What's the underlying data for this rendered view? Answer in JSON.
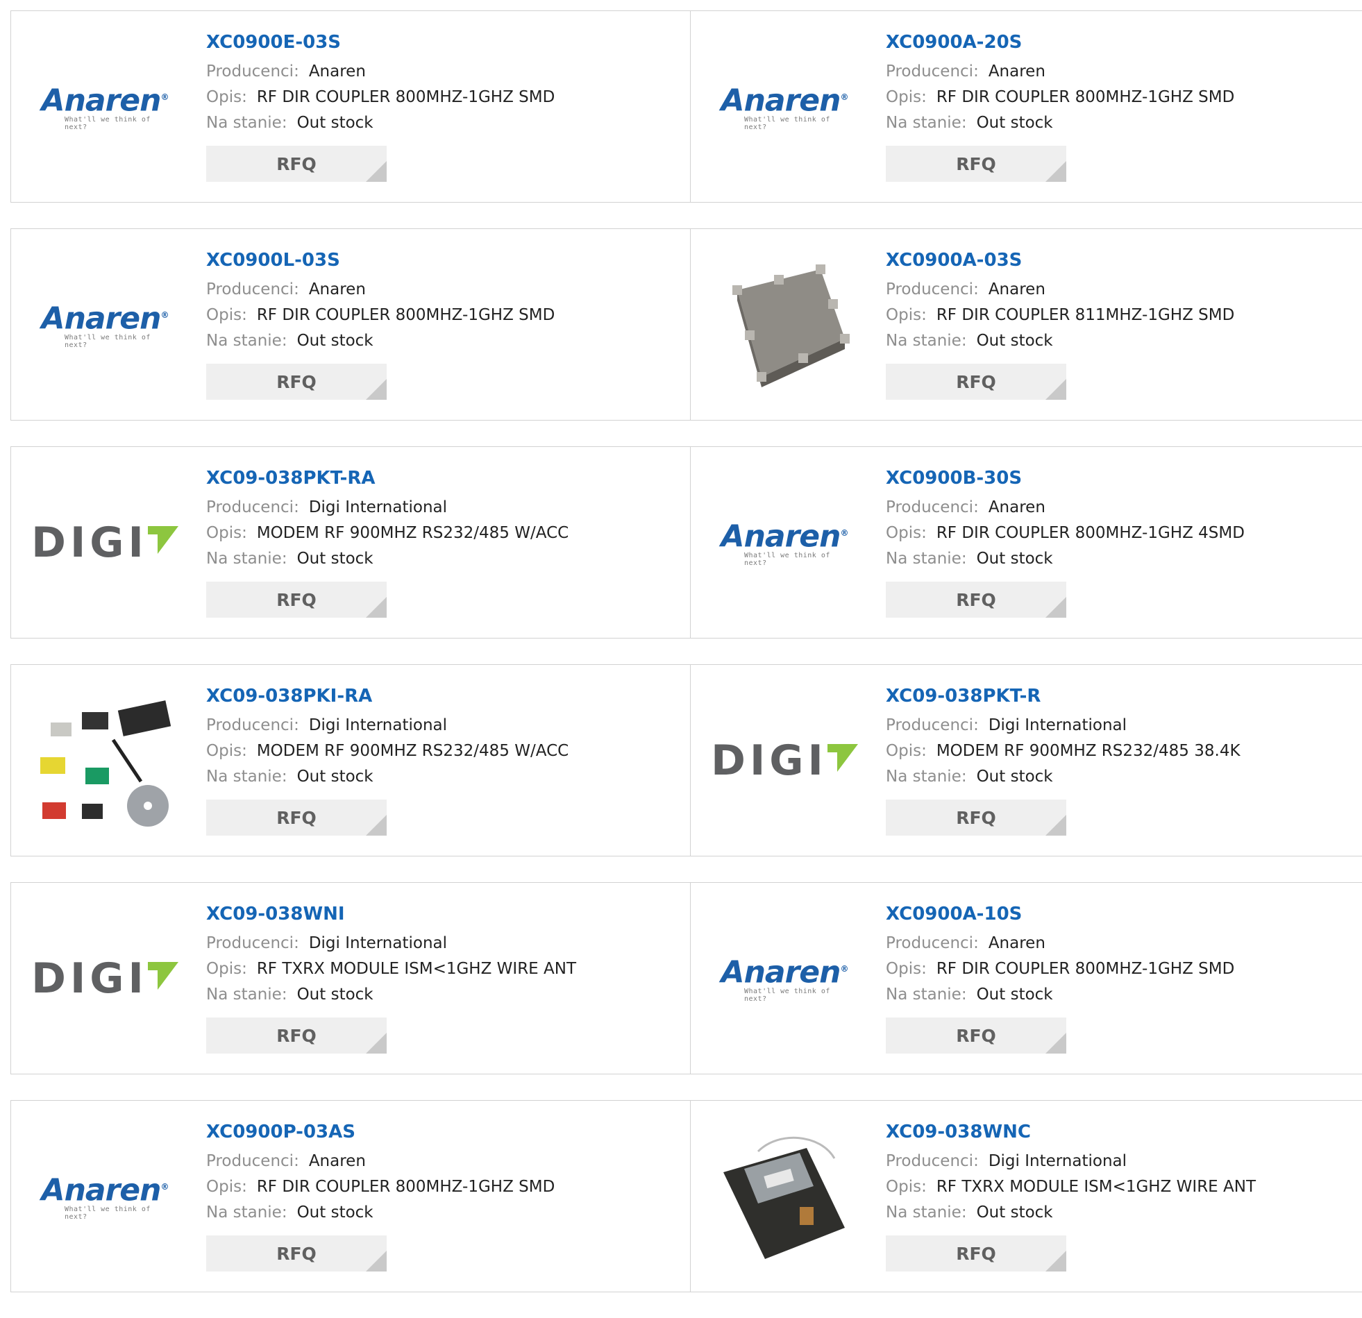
{
  "labels": {
    "manufacturer": "Producenci:",
    "description": "Opis:",
    "stock": "Na stanie:",
    "rfq": "RFQ"
  },
  "products": [
    {
      "pn": "XC0900E-03S",
      "manufacturer": "Anaren",
      "description": "RF DIR COUPLER 800MHZ-1GHZ SMD",
      "stock": "Out stock",
      "image": "anaren-logo"
    },
    {
      "pn": "XC0900A-20S",
      "manufacturer": "Anaren",
      "description": "RF DIR COUPLER 800MHZ-1GHZ SMD",
      "stock": "Out stock",
      "image": "anaren-logo"
    },
    {
      "pn": "XC0900L-03S",
      "manufacturer": "Anaren",
      "description": "RF DIR COUPLER 800MHZ-1GHZ SMD",
      "stock": "Out stock",
      "image": "anaren-logo"
    },
    {
      "pn": "XC0900A-03S",
      "manufacturer": "Anaren",
      "description": "RF DIR COUPLER 811MHZ-1GHZ SMD",
      "stock": "Out stock",
      "image": "coupler-chip-photo"
    },
    {
      "pn": "XC09-038PKT-RA",
      "manufacturer": "Digi International",
      "description": "MODEM RF 900MHZ RS232/485 W/ACC",
      "stock": "Out stock",
      "image": "digi-logo"
    },
    {
      "pn": "XC0900B-30S",
      "manufacturer": "Anaren",
      "description": "RF DIR COUPLER 800MHZ-1GHZ 4SMD",
      "stock": "Out stock",
      "image": "anaren-logo"
    },
    {
      "pn": "XC09-038PKI-RA",
      "manufacturer": "Digi International",
      "description": "MODEM RF 900MHZ RS232/485 W/ACC",
      "stock": "Out stock",
      "image": "modem-kit-photo"
    },
    {
      "pn": "XC09-038PKT-R",
      "manufacturer": "Digi International",
      "description": "MODEM RF 900MHZ RS232/485 38.4K",
      "stock": "Out stock",
      "image": "digi-logo"
    },
    {
      "pn": "XC09-038WNI",
      "manufacturer": "Digi International",
      "description": "RF TXRX MODULE ISM<1GHZ WIRE ANT",
      "stock": "Out stock",
      "image": "digi-logo"
    },
    {
      "pn": "XC0900A-10S",
      "manufacturer": "Anaren",
      "description": "RF DIR COUPLER 800MHZ-1GHZ SMD",
      "stock": "Out stock",
      "image": "anaren-logo"
    },
    {
      "pn": "XC0900P-03AS",
      "manufacturer": "Anaren",
      "description": "RF DIR COUPLER 800MHZ-1GHZ SMD",
      "stock": "Out stock",
      "image": "anaren-logo"
    },
    {
      "pn": "XC09-038WNC",
      "manufacturer": "Digi International",
      "description": "RF TXRX MODULE ISM<1GHZ WIRE ANT",
      "stock": "Out stock",
      "image": "rf-module-photo"
    }
  ],
  "logos": {
    "anaren_word": "Anaren",
    "anaren_tagline": "What'll we think of next?",
    "digi_word": "DIGI"
  },
  "colors": {
    "link": "#1565b5",
    "label": "#8e8e8e",
    "button_bg": "#efefef",
    "border": "#d2d2d2",
    "anaren_blue": "#1d5fa8",
    "digi_gray": "#5f6062",
    "digi_green": "#8dc63f"
  }
}
